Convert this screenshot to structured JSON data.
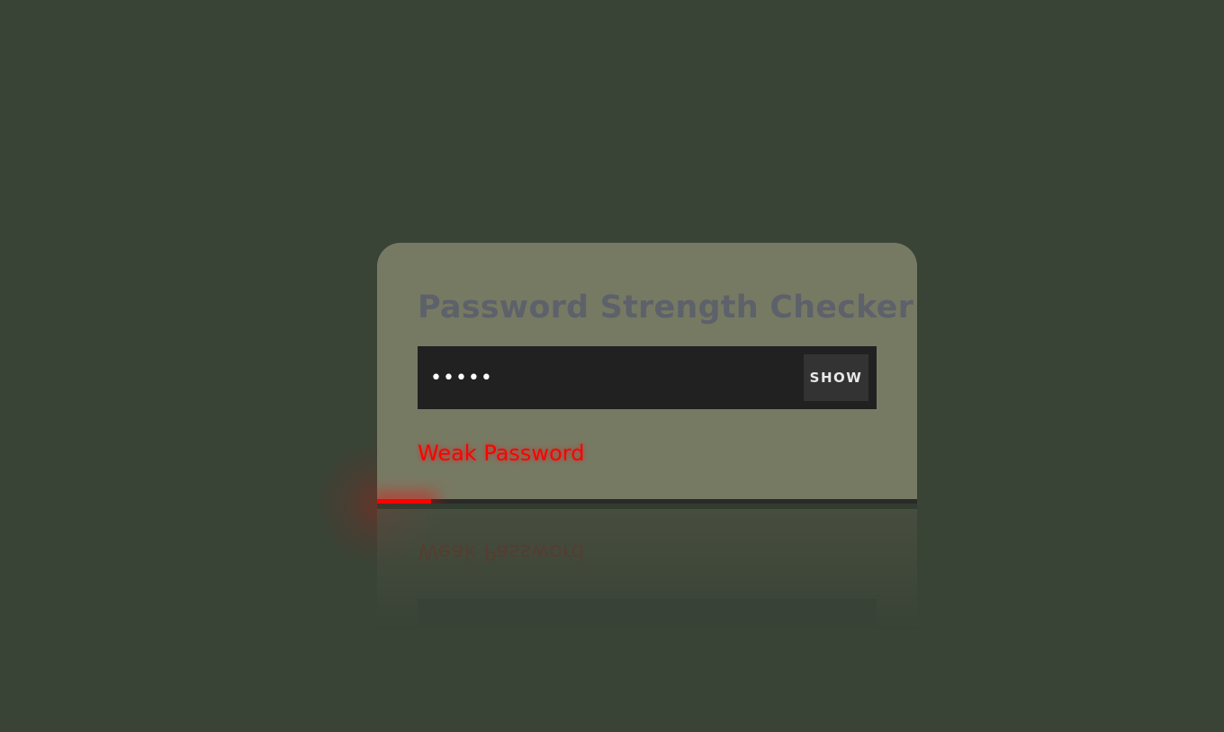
{
  "app": {
    "title": "Password Strength Checker"
  },
  "password_field": {
    "value": "12345",
    "masked_display": "•••••",
    "type": "password"
  },
  "show_button": {
    "label": "SHOW"
  },
  "strength": {
    "label": "Weak Password",
    "level": "weak",
    "fraction": 0.1,
    "color": "#ff0000"
  },
  "theme": {
    "background": "#394336",
    "card": "#777a63",
    "input_bg": "#212121",
    "title_color": "#5d616a"
  }
}
